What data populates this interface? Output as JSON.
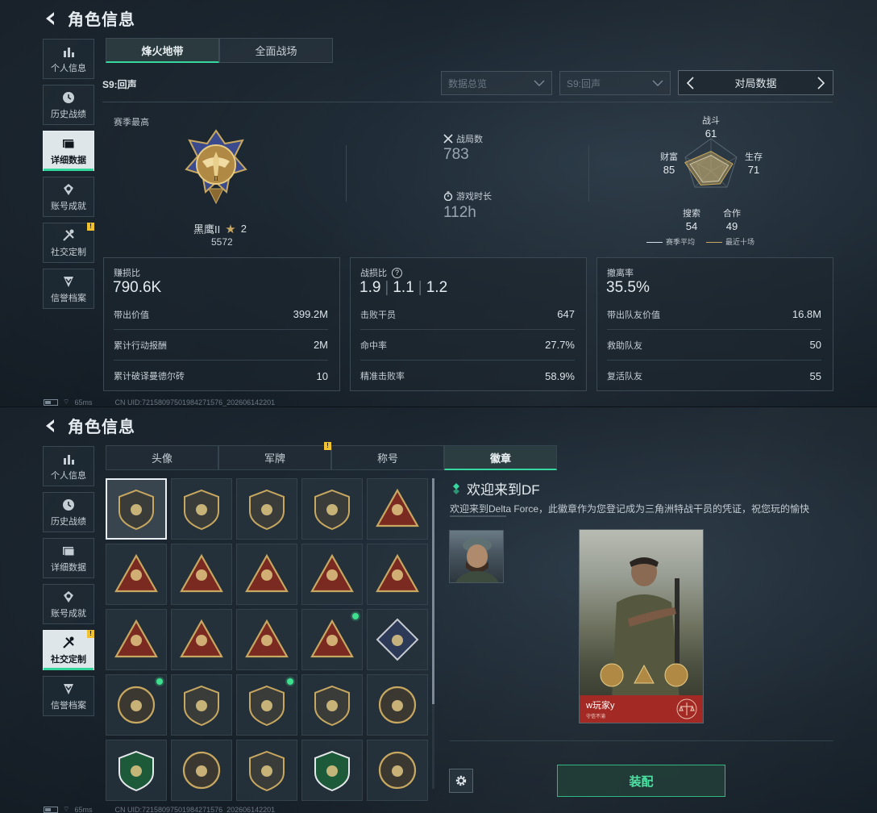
{
  "header": {
    "title": "角色信息"
  },
  "sidebar": {
    "items": [
      {
        "label": "个人信息",
        "icon": "bar-chart-icon"
      },
      {
        "label": "历史战绩",
        "icon": "clock-icon"
      },
      {
        "label": "详细数据",
        "icon": "folder-icon"
      },
      {
        "label": "账号成就",
        "icon": "achievement-icon"
      },
      {
        "label": "社交定制",
        "icon": "tools-icon",
        "notification": "!"
      },
      {
        "label": "信誉档案",
        "icon": "shield-down-icon"
      }
    ]
  },
  "status": {
    "ping": "65ms",
    "uid": "CN UID:721580975019842715​76_202606142201"
  },
  "screen1": {
    "tabs": [
      "烽火地带",
      "全面战场"
    ],
    "active_tab": "烽火地带",
    "season": "S9:回声",
    "filters": {
      "overview": "数据总览",
      "season": "S9:回声",
      "match_data": "对局数据"
    },
    "season_high_label": "赛季最高",
    "rank": {
      "name": "黑鹰II",
      "stars": "2",
      "score": "5572"
    },
    "matches": {
      "label": "战局数",
      "value": "783"
    },
    "playtime": {
      "label": "游戏时长",
      "value": "112h"
    },
    "radar": {
      "labels": {
        "combat": "战斗",
        "survival": "生存",
        "cooperation": "合作",
        "search": "搜索",
        "wealth": "财富"
      },
      "values": {
        "combat": "61",
        "survival": "71",
        "cooperation": "49",
        "search": "54",
        "wealth": "85"
      },
      "legend_avg": "赛季平均",
      "legend_recent": "最近十场",
      "avg_color": "#d8dfe4",
      "recent_color": "#c8a860"
    },
    "panel_profit": {
      "title": "赚损比",
      "value": "790.6K",
      "rows": [
        {
          "label": "带出价值",
          "value": "399.2M"
        },
        {
          "label": "累计行动报酬",
          "value": "2M"
        },
        {
          "label": "累计破译曼德尔砖",
          "value": "10"
        }
      ]
    },
    "panel_kd": {
      "title": "战损比",
      "help": "?",
      "values": [
        "1.9",
        "1.1",
        "1.2"
      ],
      "rows": [
        {
          "label": "击败干员",
          "value": "647"
        },
        {
          "label": "命中率",
          "value": "27.7%"
        },
        {
          "label": "精准击败率",
          "value": "58.9%"
        }
      ]
    },
    "panel_extract": {
      "title": "撤离率",
      "value": "35.5%",
      "rows": [
        {
          "label": "带出队友价值",
          "value": "16.8M"
        },
        {
          "label": "救助队友",
          "value": "50"
        },
        {
          "label": "复活队友",
          "value": "55"
        }
      ]
    }
  },
  "screen2": {
    "tabs": [
      "头像",
      "军牌",
      "称号",
      "徽章"
    ],
    "active_tab": "徽章",
    "badges": [
      {
        "icon": "triangle-shield-badge",
        "selected": true,
        "new": false
      },
      {
        "icon": "helicopter-badge",
        "selected": false,
        "new": false
      },
      {
        "icon": "diamond-shield-badge",
        "selected": false,
        "new": false
      },
      {
        "icon": "dagger-shield-badge",
        "selected": false,
        "new": false
      },
      {
        "icon": "s4-triangle-badge",
        "selected": false,
        "new": false
      },
      {
        "icon": "s5-triangle-badge",
        "selected": false,
        "new": false
      },
      {
        "icon": "s8-triangle-badge",
        "selected": false,
        "new": false
      },
      {
        "icon": "s9-triangle-badge",
        "selected": false,
        "new": false
      },
      {
        "icon": "hand-triangle-badge",
        "selected": false,
        "new": false
      },
      {
        "icon": "number-one-badge",
        "selected": false,
        "new": false
      },
      {
        "icon": "tower-triangle-badge",
        "selected": false,
        "new": false
      },
      {
        "icon": "horse-triangle-badge",
        "selected": false,
        "new": false
      },
      {
        "icon": "wolf-triangle-badge",
        "selected": false,
        "new": false
      },
      {
        "icon": "rocket-triangle-badge",
        "selected": false,
        "new": true
      },
      {
        "icon": "rose-diamond-badge",
        "selected": false,
        "new": false
      },
      {
        "icon": "star-wreath-badge",
        "selected": false,
        "new": true
      },
      {
        "icon": "chevron-shield-badge",
        "selected": false,
        "new": false
      },
      {
        "icon": "star-crest-badge",
        "selected": false,
        "new": true
      },
      {
        "icon": "gem-shield-badge",
        "selected": false,
        "new": false
      },
      {
        "icon": "skull-circle-badge",
        "selected": false,
        "new": false
      },
      {
        "icon": "flower-wreath-badge",
        "selected": false,
        "new": false
      },
      {
        "icon": "sunburst-badge",
        "selected": false,
        "new": false
      },
      {
        "icon": "crossed-rifle-badge",
        "selected": false,
        "new": false
      },
      {
        "icon": "green-rifle-badge",
        "selected": false,
        "new": false
      },
      {
        "icon": "slash-circle-badge",
        "selected": false,
        "new": false
      }
    ],
    "detail": {
      "title": "欢迎来到DF",
      "desc": "欢迎来到Delta Force，此徽章作为您登记成为三角洲特战干员的凭证，祝您玩的愉快",
      "player_name": "w玩家y",
      "player_sub": "守信不渝"
    },
    "equip_label": "装配",
    "colors": {
      "accent": "#37d8a0",
      "gold": "#c8a860",
      "new_dot": "#3ee08f"
    }
  }
}
